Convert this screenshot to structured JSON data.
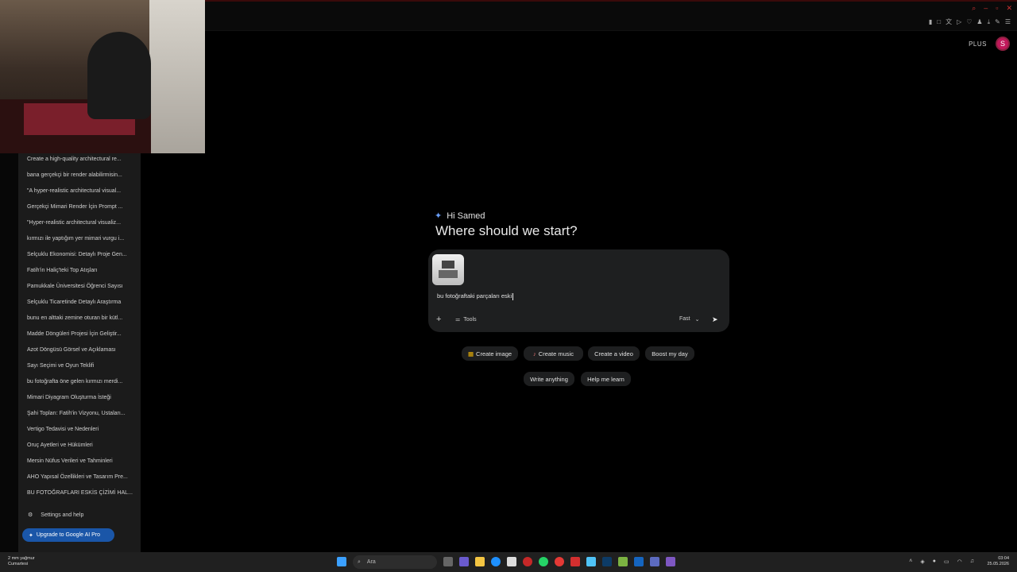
{
  "browser": {
    "plan_badge": "PLUS",
    "avatar_letter": "S"
  },
  "sidebar": {
    "chats": [
      "Create a high-quality architectural re...",
      "bana gerçekçi bir render alabilirmisin...",
      "\"A hyper-realistic architectural visual...",
      "Gerçekçi Mimari Render İçin Prompt ...",
      "\"Hyper-realistic architectural visualiz...",
      "kırmızı ile yaptığım yer mimari vurgu i...",
      "Selçuklu Ekonomisi: Detaylı Proje Gen...",
      "Fatih'in Haliç'teki Top Atışları",
      "Pamukkale Üniversitesi Öğrenci Sayısı",
      "Selçuklu Ticaretinde Detaylı Araştırma",
      "bunu en alttaki zemine oturan bir kütl...",
      "Madde Döngüleri Projesi İçin Geliştir...",
      "Azot Döngüsü Görsel ve Açıklaması",
      "Sayı Seçimi ve Oyun Teklifi",
      "bu fotoğrafta öne gelen kırmızı merdi...",
      "Mimari Diyagram Oluşturma İsteği",
      "Şahi Topları: Fatih'in Vizyonu, Ustaları...",
      "Vertigo Tedavisi ve Nedenleri",
      "Oruç Ayetleri ve Hükümleri",
      "Mersin Nüfus Verileri ve Tahminleri",
      "AHO Yapısal Özellikleri ve Tasarım Pre...",
      "BU FOTOĞRAFLARI ESKİS ÇİZİMİ HAL..."
    ],
    "settings_label": "Settings and help",
    "upgrade_label": "Upgrade to Google AI Pro"
  },
  "main": {
    "greeting": "Hi Samed",
    "headline": "Where should we start?",
    "prompt_text": "bu fotoğraftaki parçaları eski",
    "tools_label": "Tools",
    "model_label": "Fast",
    "chips_row1": [
      "Create image",
      "Create music",
      "Create a video",
      "Boost my day"
    ],
    "chips_row2": [
      "Write anything",
      "Help me learn"
    ]
  },
  "taskbar": {
    "weather_line1": "2 mm yağmur",
    "weather_line2": "Cumartesi",
    "search_placeholder": "Ara",
    "time": "03:04",
    "date": "25.05.2026"
  }
}
